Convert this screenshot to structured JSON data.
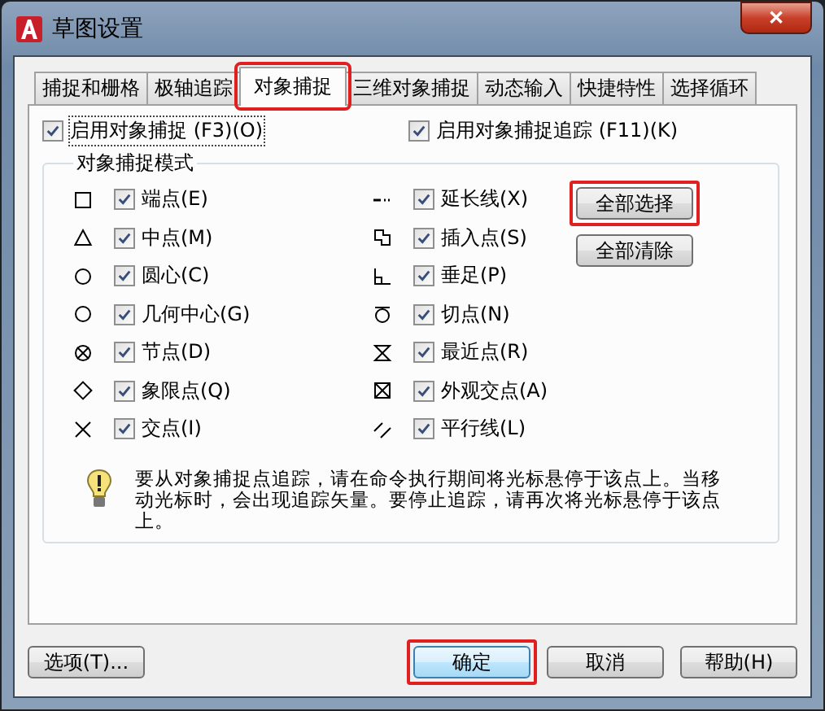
{
  "window": {
    "title": "草图设置",
    "close": "✕"
  },
  "tabs": [
    {
      "label": "捕捉和栅格",
      "selected": false,
      "highlighted": false
    },
    {
      "label": "极轴追踪",
      "selected": false,
      "highlighted": false
    },
    {
      "label": "对象捕捉",
      "selected": true,
      "highlighted": true
    },
    {
      "label": "三维对象捕捉",
      "selected": false,
      "highlighted": false
    },
    {
      "label": "动态输入",
      "selected": false,
      "highlighted": false
    },
    {
      "label": "快捷特性",
      "selected": false,
      "highlighted": false
    },
    {
      "label": "选择循环",
      "selected": false,
      "highlighted": false
    }
  ],
  "toggles": [
    {
      "label": "启用对象捕捉 (F3)(O)",
      "checked": true,
      "focused": true
    },
    {
      "label": "启用对象捕捉追踪 (F11)(K)",
      "checked": true,
      "focused": false
    }
  ],
  "modes_group": {
    "title": "对象捕捉模式",
    "left": [
      {
        "kind": "square",
        "label": "端点(E)",
        "checked": true
      },
      {
        "kind": "triangle",
        "label": "中点(M)",
        "checked": true
      },
      {
        "kind": "circle",
        "label": "圆心(C)",
        "checked": true
      },
      {
        "kind": "circle",
        "label": "几何中心(G)",
        "checked": true
      },
      {
        "kind": "node",
        "label": "节点(D)",
        "checked": true
      },
      {
        "kind": "diamond",
        "label": "象限点(Q)",
        "checked": true
      },
      {
        "kind": "cross",
        "label": "交点(I)",
        "checked": true
      }
    ],
    "right": [
      {
        "kind": "extension",
        "label": "延长线(X)",
        "checked": true
      },
      {
        "kind": "insertion",
        "label": "插入点(S)",
        "checked": true
      },
      {
        "kind": "perpendicular",
        "label": "垂足(P)",
        "checked": true
      },
      {
        "kind": "tangent",
        "label": "切点(N)",
        "checked": true
      },
      {
        "kind": "nearest",
        "label": "最近点(R)",
        "checked": true
      },
      {
        "kind": "apparent",
        "label": "外观交点(A)",
        "checked": true
      },
      {
        "kind": "parallel",
        "label": "平行线(L)",
        "checked": true
      }
    ],
    "buttons": [
      {
        "label": "全部选择",
        "highlighted": true
      },
      {
        "label": "全部清除",
        "highlighted": false
      }
    ]
  },
  "hint": "要从对象捕捉点追踪，请在命令执行期间将光标悬停于该点上。当移动光标时，会出现追踪矢量。要停止追踪，请再次将光标悬停于该点上。",
  "footer": {
    "options": "选项(T)...",
    "buttons": [
      {
        "label": "确定",
        "highlighted": true,
        "default": true
      },
      {
        "label": "取消",
        "highlighted": false,
        "default": false
      },
      {
        "label": "帮助(H)",
        "highlighted": false,
        "default": false
      }
    ]
  }
}
